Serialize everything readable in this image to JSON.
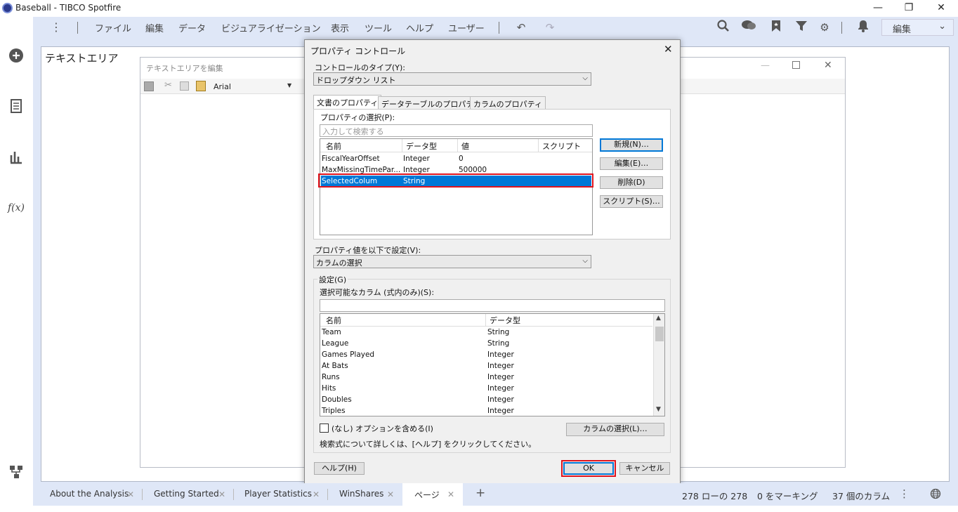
{
  "window": {
    "title": "Baseball - TIBCO Spotfire",
    "min": "—",
    "restore": "❐",
    "close": "✕"
  },
  "menu": [
    "ファイル",
    "編集",
    "データ",
    "ビジュアライゼーション",
    "表示",
    "ツール",
    "ヘルプ",
    "ユーザー"
  ],
  "mode_select": "編集",
  "panel_title": "テキストエリア",
  "editor": {
    "title": "テキストエリアを編集",
    "font": "Arial"
  },
  "dialog": {
    "title": "プロパティ コントロール",
    "control_type_label": "コントロールのタイプ(Y):",
    "control_type_value": "ドロップダウン リスト",
    "tabs": [
      "文書のプロパティ",
      "データテーブルのプロパティ",
      "カラムのプロパティ"
    ],
    "property_select_label": "プロパティの選択(P):",
    "search_placeholder": "入力して検索する",
    "prop_columns": [
      "名前",
      "データ型",
      "値",
      "スクリプト"
    ],
    "prop_rows": [
      {
        "name": "FiscalYearOffset",
        "type": "Integer",
        "value": "0"
      },
      {
        "name": "MaxMissingTimePar...",
        "type": "Integer",
        "value": "500000"
      },
      {
        "name": "SelectedColum",
        "type": "String",
        "value": ""
      }
    ],
    "buttons": {
      "new": "新規(N)…",
      "edit": "編集(E)…",
      "delete": "削除(D)",
      "script": "スクリプト(S)…"
    },
    "set_value_label": "プロパティ値を以下で設定(V):",
    "set_value_value": "カラムの選択",
    "settings_group": "設定(G)",
    "selectable_label": "選択可能なカラム (式内のみ)(S):",
    "col_columns": [
      "名前",
      "データ型"
    ],
    "col_rows": [
      {
        "name": "Team",
        "type": "String"
      },
      {
        "name": "League",
        "type": "String"
      },
      {
        "name": "Games Played",
        "type": "Integer"
      },
      {
        "name": "At Bats",
        "type": "Integer"
      },
      {
        "name": "Runs",
        "type": "Integer"
      },
      {
        "name": "Hits",
        "type": "Integer"
      },
      {
        "name": "Doubles",
        "type": "Integer"
      },
      {
        "name": "Triples",
        "type": "Integer"
      }
    ],
    "include_none_label": "(なし) オプションを含める(I)",
    "select_columns_button": "カラムの選択(L)…",
    "help_note": "検索式について詳しくは、[ヘルプ] をクリックしてください。",
    "help_button": "ヘルプ(H)",
    "ok_button": "OK",
    "cancel_button": "キャンセル",
    "close_glyph": "✕"
  },
  "page_tabs": [
    "About the Analysis",
    "Getting Started",
    "Player Statistics",
    "WinShares",
    "ページ"
  ],
  "add_tab": "+",
  "tab_close": "✕",
  "status": {
    "rows": "278 ローの 278",
    "marked": "0 をマーキング",
    "columns": "37 個のカラム"
  },
  "colors": {
    "accent_blue": "#0078d7",
    "highlight_red": "#e0141e",
    "toolbar_bg": "#dfe7f7"
  }
}
